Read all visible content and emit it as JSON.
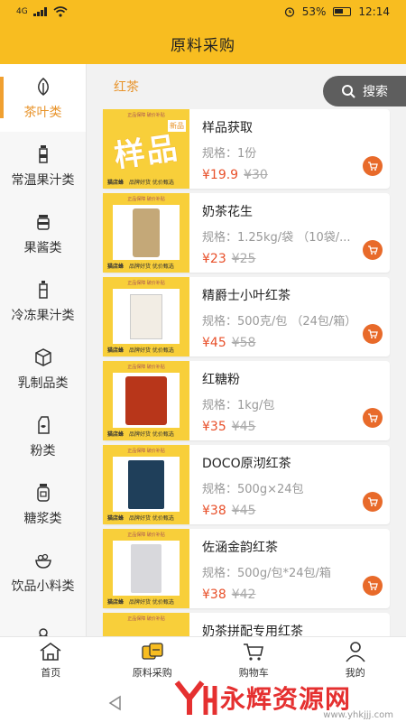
{
  "status_bar": {
    "signal": "4G",
    "battery": "53%",
    "time": "12:14"
  },
  "header": {
    "title": "原料采购"
  },
  "sidebar": {
    "items": [
      {
        "label": "茶叶类",
        "icon": "leaf-icon",
        "active": true
      },
      {
        "label": "常温果汁类",
        "icon": "bottle-icon"
      },
      {
        "label": "果酱类",
        "icon": "jar-icon"
      },
      {
        "label": "冷冻果汁类",
        "icon": "bottle-icon"
      },
      {
        "label": "乳制品类",
        "icon": "box-icon"
      },
      {
        "label": "粉类",
        "icon": "milk-carton-icon"
      },
      {
        "label": "糖浆类",
        "icon": "syrup-jar-icon"
      },
      {
        "label": "饮品小料类",
        "icon": "bowl-icon"
      },
      {
        "label": "",
        "icon": "ice-cream-icon"
      }
    ]
  },
  "main": {
    "subcategory": "红茶",
    "search_label": "搜索",
    "products": [
      {
        "name": "样品获取",
        "spec": "规格：1份",
        "price": "¥19.9",
        "old_price": "¥30",
        "thumb_text": "样品",
        "badge": "新品"
      },
      {
        "name": "奶茶花生",
        "spec": "规格：1.25kg/袋 （10袋/...",
        "price": "¥23",
        "old_price": "¥25"
      },
      {
        "name": "精爵士小叶红茶",
        "spec": "规格：500克/包 （24包/箱）",
        "price": "¥45",
        "old_price": "¥58"
      },
      {
        "name": "红糖粉",
        "spec": "规格：1kg/包",
        "price": "¥35",
        "old_price": "¥45"
      },
      {
        "name": "DOCO原沏红茶",
        "spec": "规格：500g×24包",
        "price": "¥38",
        "old_price": "¥45"
      },
      {
        "name": "佐涵金韵红茶",
        "spec": "规格：500g/包*24包/箱",
        "price": "¥38",
        "old_price": "¥42"
      },
      {
        "name": "奶茶拼配专用红茶",
        "spec": "",
        "price": "",
        "old_price": ""
      }
    ],
    "thumb_banner_top": "正品保障 破价补贴",
    "thumb_banner_bottom": "品牌好货 优价甄选",
    "thumb_logo": "猫店蜂"
  },
  "tabbar": {
    "tabs": [
      {
        "label": "首页",
        "icon": "home-icon"
      },
      {
        "label": "原料采购",
        "icon": "purchase-icon"
      },
      {
        "label": "购物车",
        "icon": "cart-icon"
      },
      {
        "label": "我的",
        "icon": "user-icon"
      }
    ]
  },
  "watermark": {
    "text": "永辉资源网",
    "url": "www.yhkjjj.com"
  },
  "colors": {
    "accent": "#f8bd20",
    "active_text": "#e8932a",
    "price": "#e8502a"
  }
}
